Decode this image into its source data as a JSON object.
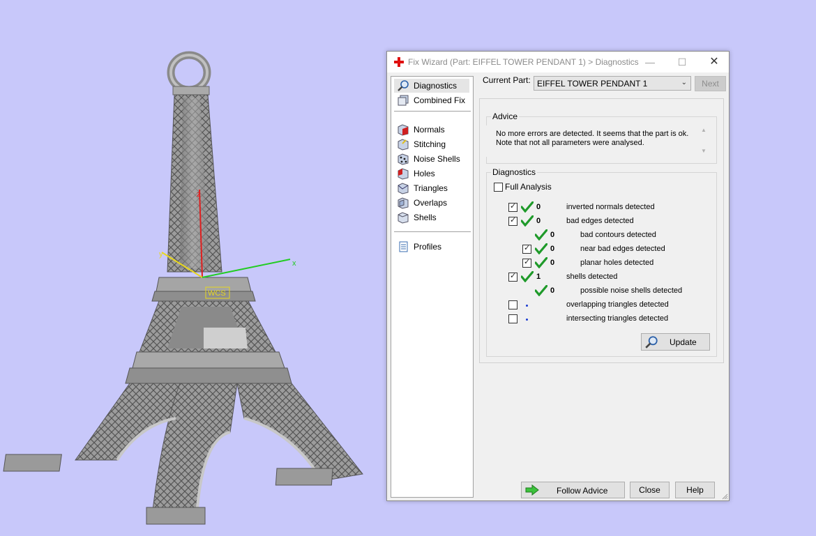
{
  "window": {
    "title": "Fix Wizard (Part: EIFFEL TOWER PENDANT 1) > Diagnostics",
    "minimize_glyph": "—",
    "maximize_glyph": "☐",
    "close_glyph": "✕"
  },
  "nav": {
    "items": [
      {
        "label": "Diagnostics",
        "icon": "magnifier-icon"
      },
      {
        "label": "Combined Fix",
        "icon": "combined-fix-icon"
      },
      {
        "label": "Normals",
        "icon": "normals-icon"
      },
      {
        "label": "Stitching",
        "icon": "stitching-icon"
      },
      {
        "label": "Noise Shells",
        "icon": "noise-shells-icon"
      },
      {
        "label": "Holes",
        "icon": "holes-icon"
      },
      {
        "label": "Triangles",
        "icon": "triangles-icon"
      },
      {
        "label": "Overlaps",
        "icon": "overlaps-icon"
      },
      {
        "label": "Shells",
        "icon": "shells-icon"
      },
      {
        "label": "Profiles",
        "icon": "document-icon"
      }
    ],
    "selected": "Diagnostics"
  },
  "part": {
    "label": "Current Part:",
    "value": "EIFFEL TOWER PENDANT 1",
    "next_label": "Next"
  },
  "advice": {
    "title": "Advice",
    "line1": "No more errors are detected. It seems that the part is ok.",
    "line2": "Note that not all parameters were analysed."
  },
  "diagnostics": {
    "title": "Diagnostics",
    "full_analysis_label": "Full Analysis",
    "full_analysis_checked": false,
    "rows": [
      {
        "checkbox": true,
        "checked": true,
        "status": "ok",
        "count": "0",
        "label": "inverted normals detected",
        "indent": 0
      },
      {
        "checkbox": true,
        "checked": true,
        "status": "ok",
        "count": "0",
        "label": "bad edges detected",
        "indent": 0
      },
      {
        "checkbox": false,
        "checked": false,
        "status": "ok",
        "count": "0",
        "label": "bad contours detected",
        "indent": 1
      },
      {
        "checkbox": true,
        "checked": true,
        "status": "ok",
        "count": "0",
        "label": "near bad edges detected",
        "indent": 1
      },
      {
        "checkbox": true,
        "checked": true,
        "status": "ok",
        "count": "0",
        "label": "planar holes detected",
        "indent": 1
      },
      {
        "checkbox": true,
        "checked": true,
        "status": "ok",
        "count": "1",
        "label": "shells detected",
        "indent": 0
      },
      {
        "checkbox": false,
        "checked": false,
        "status": "ok",
        "count": "0",
        "label": "possible noise shells detected",
        "indent": 1
      },
      {
        "checkbox": true,
        "checked": false,
        "status": "pending",
        "count": "",
        "label": "overlapping triangles detected",
        "indent": 0
      },
      {
        "checkbox": true,
        "checked": false,
        "status": "pending",
        "count": "",
        "label": "intersecting triangles detected",
        "indent": 0
      }
    ],
    "update_label": "Update"
  },
  "buttons": {
    "follow_advice": "Follow Advice",
    "close": "Close",
    "help": "Help"
  },
  "viewport": {
    "axis_x_label": "x",
    "axis_y_label": "y",
    "axis_z_label": "z",
    "wcs_label": "WCS",
    "colors": {
      "background": "#c8c8fa",
      "x_axis": "#22cc22",
      "y_axis": "#e8d820",
      "z_axis": "#e02020",
      "model": "#9a9a9a"
    }
  }
}
